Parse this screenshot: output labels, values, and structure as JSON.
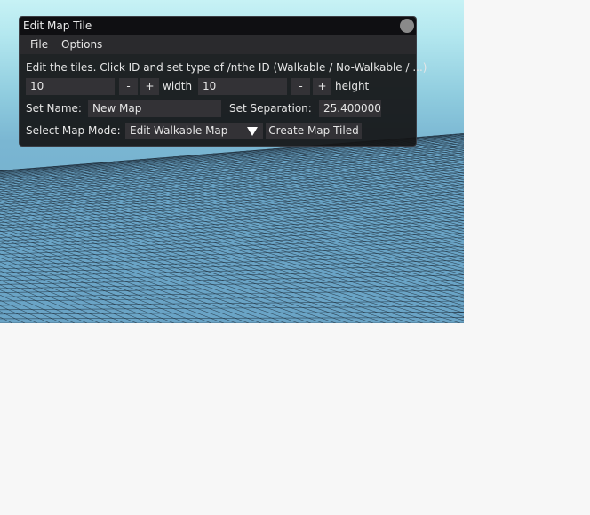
{
  "window": {
    "title": "Edit Map Tile",
    "menu": [
      "File",
      "Options"
    ],
    "description": "Edit the tiles. Click ID and set type of /nthe ID (Walkable / No-Walkable / ...)",
    "width": {
      "value": "10",
      "minus": "-",
      "plus": "+",
      "label": "width"
    },
    "height": {
      "value": "10",
      "minus": "-",
      "plus": "+",
      "label": "height"
    },
    "name": {
      "label": "Set Name:",
      "value": "New Map"
    },
    "separation": {
      "label": "Set Separation:",
      "value": "25.400000"
    },
    "mode": {
      "label": "Select Map Mode:",
      "selected": "Edit Walkable Map"
    },
    "create_button": "Create Map Tiled"
  },
  "colors": {
    "sky_top": "#c7f2f5",
    "grid_plane": "#6aa4c6",
    "window_bg": "#141416",
    "field_bg": "#333236"
  }
}
